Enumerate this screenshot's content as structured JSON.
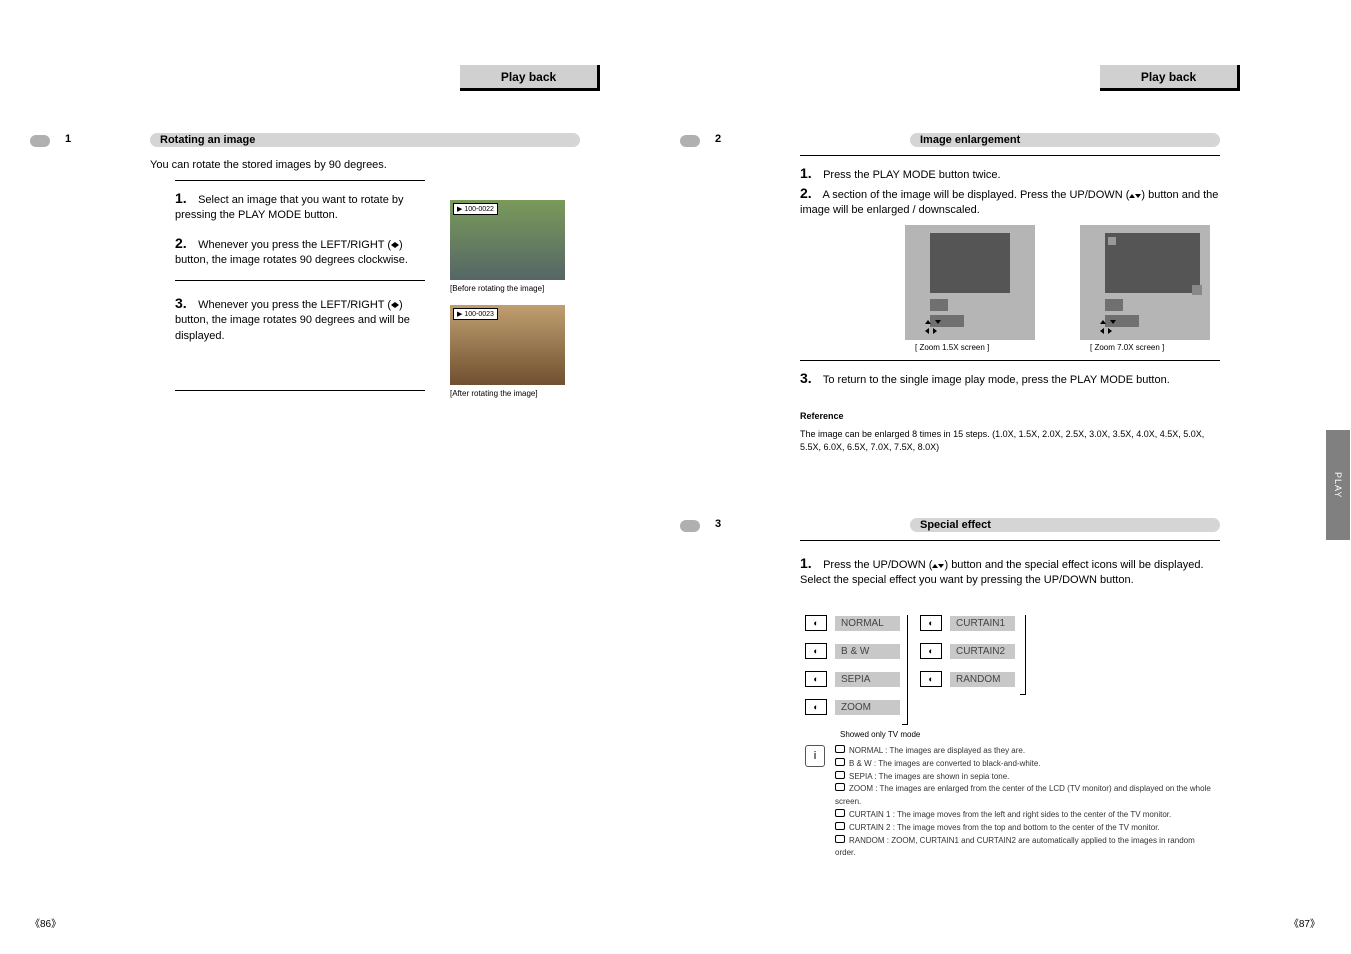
{
  "left": {
    "header": "Play back",
    "section1": {
      "num": "1",
      "title": "Rotating an image",
      "intro": "You can rotate the stored images by 90 degrees.",
      "step1_label": "1.",
      "step1_text": "Select an image that you want to rotate by pressing the PLAY MODE button.",
      "step2_label": "2.",
      "step2_text": "Whenever you press the LEFT/RIGHT (◀ ▶) button, the image rotates 90 degrees clockwise.",
      "step3_label": "3.",
      "step3_text": "Whenever you press the LEFT/RIGHT (◀ ▶) button, the image rotates 90 degrees and will be displayed.",
      "img1_caption": "▶ 100-0022",
      "img2_caption": "▶ 100-0023",
      "caption1": "[Before rotating the image]",
      "caption2": "[After rotating the image]"
    },
    "pagenum": "《86》"
  },
  "right": {
    "header": "Play back",
    "section2": {
      "num": "2",
      "title": "Image enlargement",
      "step1_label": "1.",
      "step1_text": "Press the PLAY MODE button twice.",
      "step2_label": "2.",
      "step2_text": "A section of the image will be displayed. Press the UP/DOWN (▲▼) button and the image will be enlarged / downscaled.",
      "lcd1_caption": "[ Zoom 1.5X screen ]",
      "lcd2_caption": "[ Zoom 7.0X screen ]",
      "step3_label": "3.",
      "step3_text": "To return to the single image play mode, press the PLAY MODE button.",
      "note_title": "Reference",
      "note_body": "The image can be enlarged 8 times in 15 steps. (1.0X, 1.5X, 2.0X, 2.5X, 3.0X, 3.5X, 4.0X, 4.5X, 5.0X, 5.5X, 6.0X, 6.5X, 7.0X, 7.5X, 8.0X)"
    },
    "section3": {
      "num": "3",
      "title": "Special effect",
      "step1_label": "1.",
      "step1_text": "Press the UP/DOWN (▲▼) button and the special effect icons will be displayed. Select the special effect you want by pressing the UP/DOWN button.",
      "effects_col1": [
        {
          "icon": "◐",
          "label": "NORMAL"
        },
        {
          "icon": "◐",
          "label": "B & W"
        },
        {
          "icon": "◐",
          "label": "SEPIA"
        },
        {
          "icon": "◐",
          "label": "ZOOM"
        }
      ],
      "effects_col2": [
        {
          "icon": "◐",
          "label": "CURTAIN1"
        },
        {
          "icon": "◐",
          "label": "CURTAIN2"
        },
        {
          "icon": "◐",
          "label": "RANDOM"
        }
      ],
      "bracket_note": "Showed only TV mode",
      "info_items": [
        "NORMAL : The images are displayed as they are.",
        "B & W : The images are converted to black-and-white.",
        "SEPIA : The images are shown in sepia tone.",
        "ZOOM : The images are enlarged from the center of the LCD (TV monitor) and displayed on the whole screen.",
        "CURTAIN 1 : The image moves from the left and right sides to the center of the TV monitor.",
        "CURTAIN 2 : The image moves from the top and bottom to the center of the TV monitor.",
        "RANDOM : ZOOM, CURTAIN1 and CURTAIN2 are automatically applied to the images in random order."
      ]
    },
    "side_tab": "PLAY",
    "pagenum": "《87》"
  }
}
